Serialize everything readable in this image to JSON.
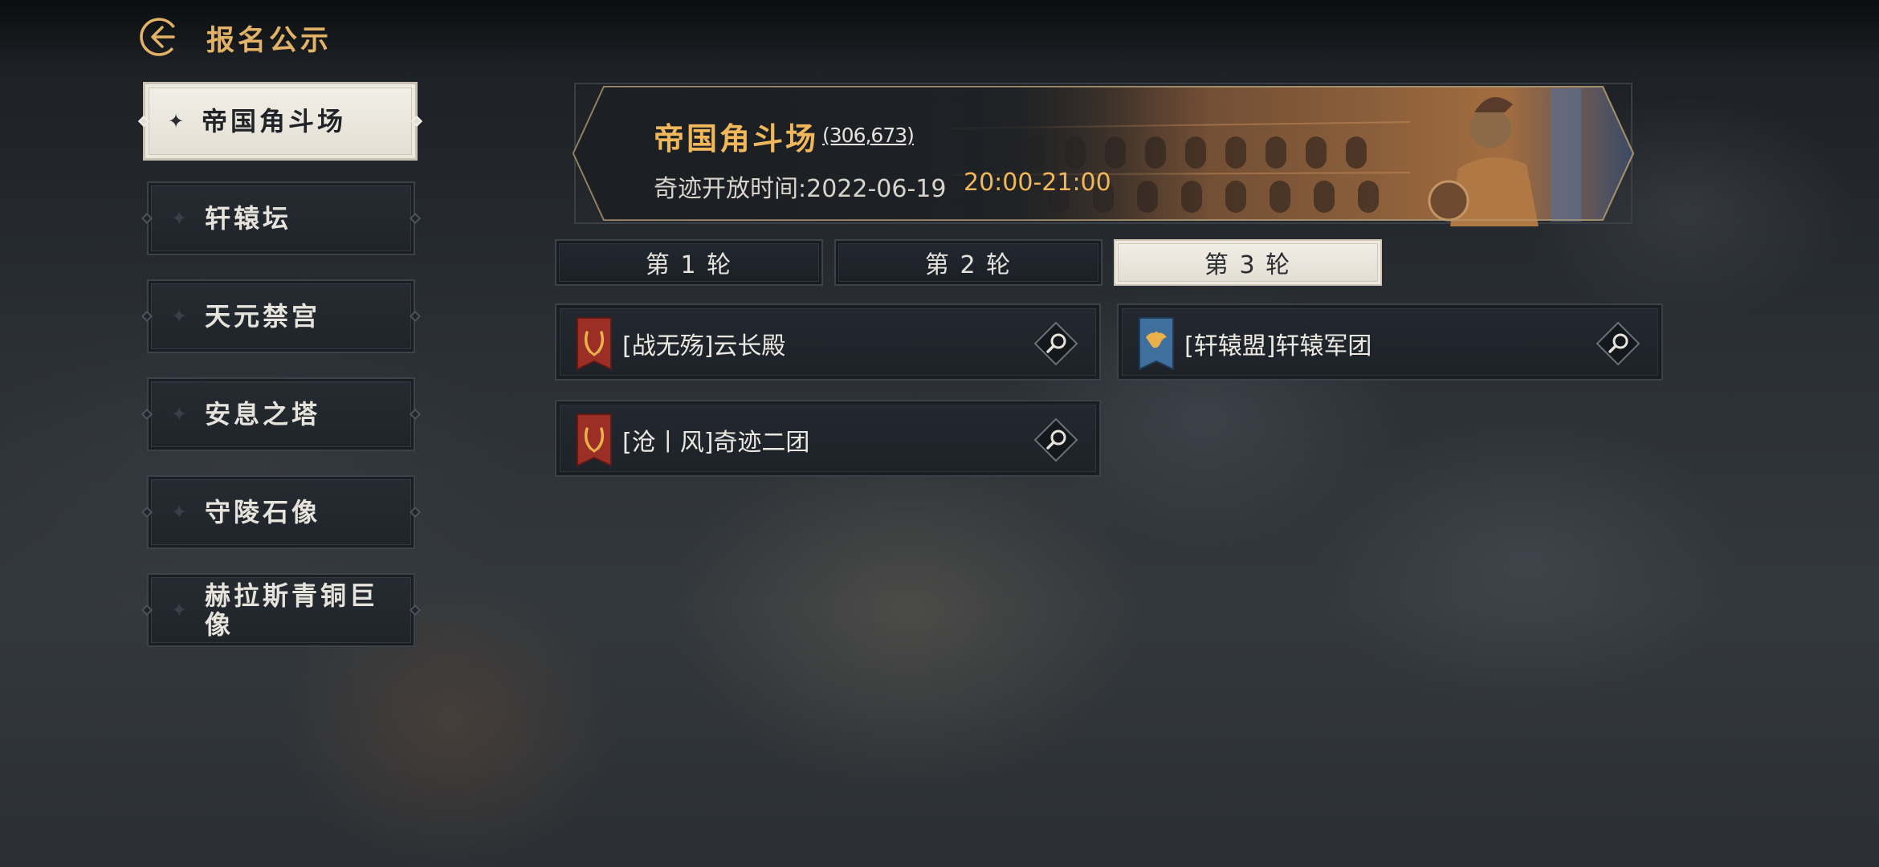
{
  "header": {
    "title": "报名公示",
    "back_icon": "back-arrow-icon"
  },
  "sidebar": {
    "items": [
      {
        "label": "帝国角斗场",
        "active": true
      },
      {
        "label": "轩辕坛",
        "active": false
      },
      {
        "label": "天元禁宫",
        "active": false
      },
      {
        "label": "安息之塔",
        "active": false
      },
      {
        "label": "守陵石像",
        "active": false
      },
      {
        "label": "赫拉斯青铜巨像",
        "active": false
      }
    ]
  },
  "banner": {
    "title": "帝国角斗场",
    "count": "(306,673)",
    "time_label": "奇迹开放时间:2022-06-19",
    "time_range": "20:00-21:00"
  },
  "rounds": {
    "tabs": [
      {
        "label": "第 1 轮",
        "active": false
      },
      {
        "label": "第 2 轮",
        "active": false
      },
      {
        "label": "第 3 轮",
        "active": true
      }
    ]
  },
  "entries": [
    {
      "name": "[战无殇]云长殿",
      "flag_color": "#9c2f25",
      "emblem": "laurel-icon"
    },
    {
      "name": "[轩辕盟]轩辕军团",
      "flag_color": "#3f6f9c",
      "emblem": "eagle-icon"
    },
    {
      "name": "[沧丨风]奇迹二团",
      "flag_color": "#9c2f25",
      "emblem": "laurel-icon"
    }
  ],
  "colors": {
    "accent_gold": "#f0b85a",
    "title_gold": "#e2b266",
    "active_tab_bg": "#f2efe7"
  }
}
